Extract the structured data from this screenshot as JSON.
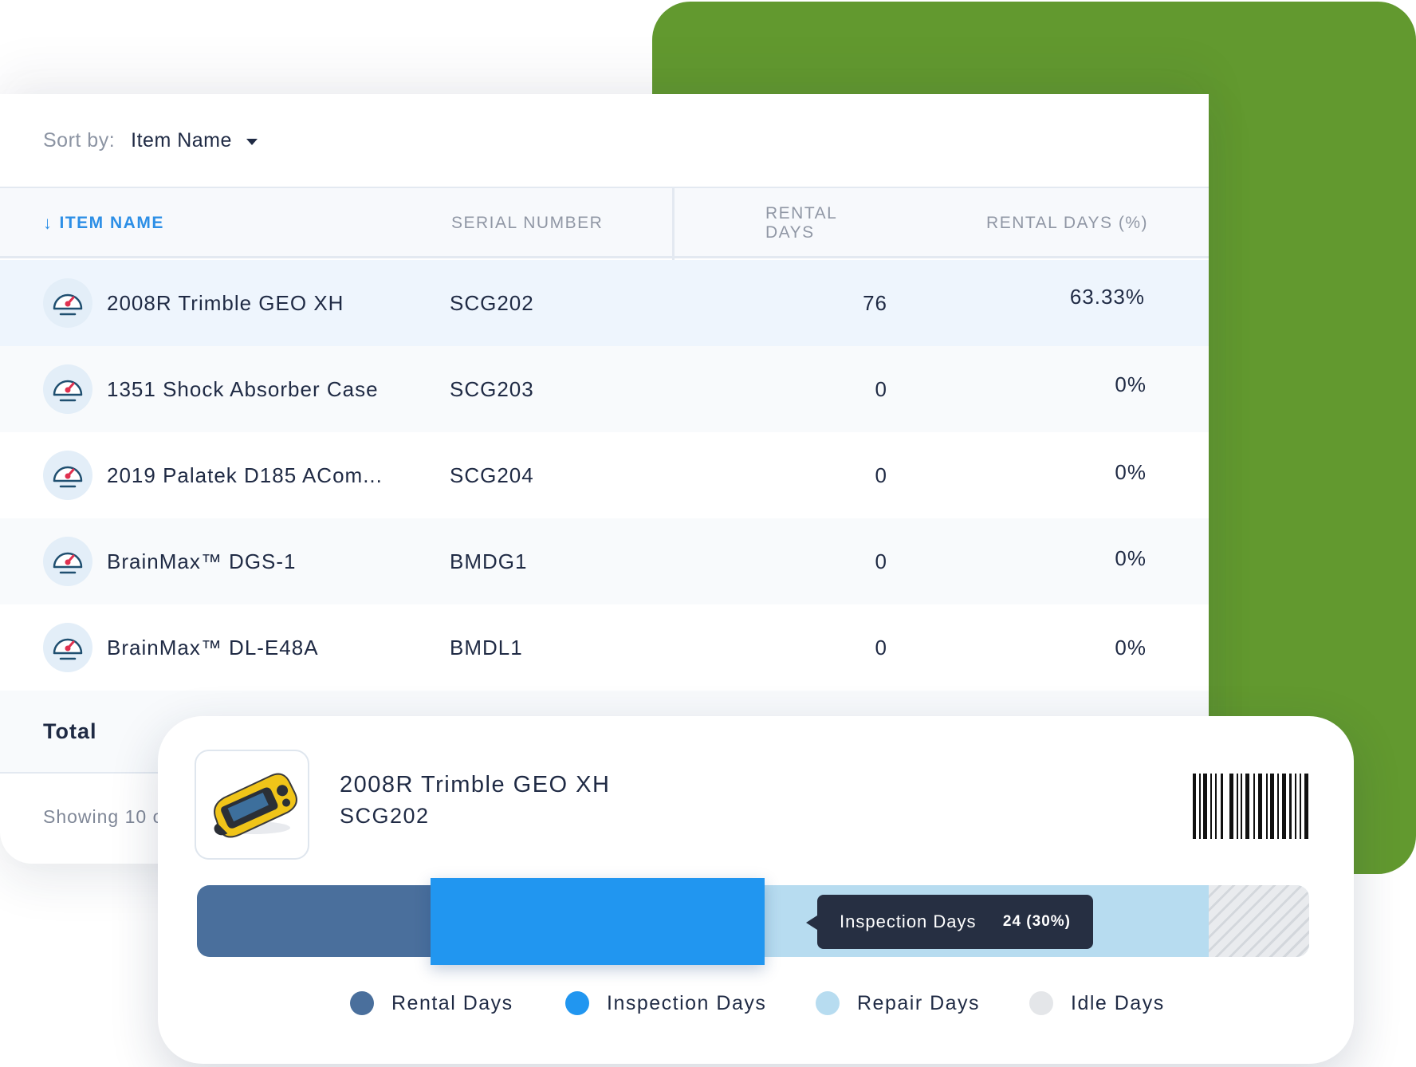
{
  "sort": {
    "label": "Sort by:",
    "value": "Item Name"
  },
  "table": {
    "columns": {
      "item_name": "ITEM NAME",
      "serial_number": "SERIAL NUMBER",
      "rental_days": "RENTAL DAYS",
      "rental_days_pct": "RENTAL DAYS (%)"
    },
    "rows": [
      {
        "name": "2008R Trimble GEO XH",
        "serial": "SCG202",
        "rental_days": "76",
        "rental_pct": "63.33%"
      },
      {
        "name": "1351 Shock Absorber Case",
        "serial": "SCG203",
        "rental_days": "0",
        "rental_pct": "0%"
      },
      {
        "name": "2019 Palatek D185 ACom...",
        "serial": "SCG204",
        "rental_days": "0",
        "rental_pct": "0%"
      },
      {
        "name": "BrainMax™ DGS-1",
        "serial": "BMDG1",
        "rental_days": "0",
        "rental_pct": "0%"
      },
      {
        "name": "BrainMax™ DL-E48A",
        "serial": "BMDL1",
        "rental_days": "0",
        "rental_pct": "0%"
      }
    ],
    "row_icon": "gauge-icon",
    "total_label": "Total",
    "showing_text": "Showing 10 o"
  },
  "detail": {
    "name": "2008R Trimble GEO XH",
    "serial": "SCG202",
    "thumbnail_icon": "gps-device-icon",
    "barcode_icon": "barcode-icon",
    "tooltip": {
      "label": "Inspection Days",
      "value": "24 (30%)"
    },
    "breakdown": [
      {
        "name": "Rental Days",
        "fraction": 0.21,
        "color": "#4a6f9c"
      },
      {
        "name": "Inspection Days",
        "fraction": 0.3,
        "color": "#2196f0"
      },
      {
        "name": "Repair Days",
        "fraction": 0.4,
        "color": "#b7dcf0"
      },
      {
        "name": "Idle Days",
        "fraction": 0.09,
        "color": "#e4e6e9"
      }
    ],
    "legend": [
      {
        "label": "Rental Days",
        "color": "#4a6f9c"
      },
      {
        "label": "Inspection Days",
        "color": "#2196f0"
      },
      {
        "label": "Repair Days",
        "color": "#b7dcf0"
      },
      {
        "label": "Idle Days",
        "color": "#e4e6e9"
      }
    ]
  },
  "colors": {
    "accent": "#2d8fe6",
    "green": "#62992f",
    "dark_text": "#1f2a44",
    "tooltip_bg": "#262f42"
  }
}
